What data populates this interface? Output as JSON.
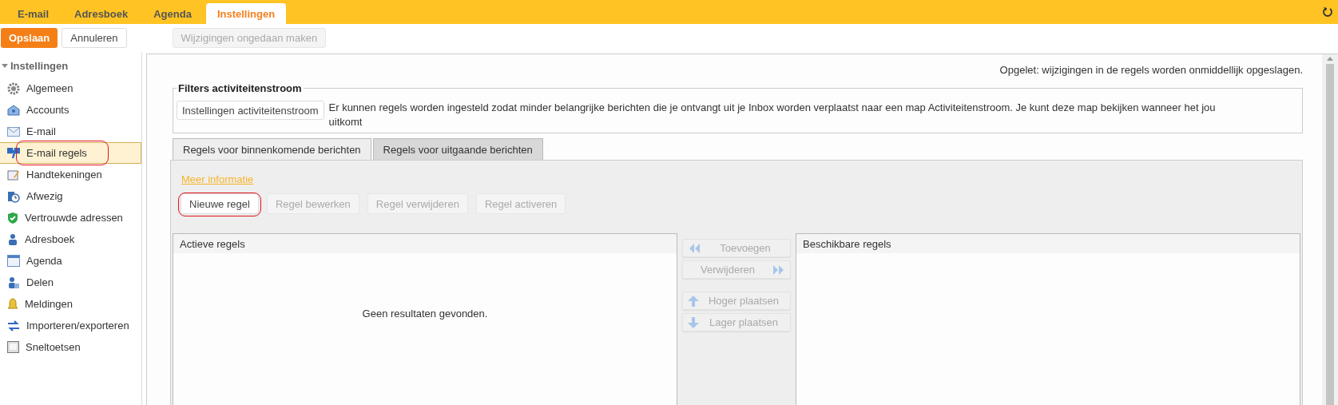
{
  "top_tabs": [
    {
      "label": "E-mail",
      "selected": false
    },
    {
      "label": "Adresboek",
      "selected": false
    },
    {
      "label": "Agenda",
      "selected": false
    },
    {
      "label": "Instellingen",
      "selected": true
    }
  ],
  "toolbar": {
    "save": "Opslaan",
    "cancel": "Annuleren",
    "undo": {
      "label": "Wijzigingen ongedaan maken",
      "disabled": true
    }
  },
  "sidebar": {
    "title": "Instellingen",
    "expanded": true,
    "items": [
      {
        "label": "Algemeen",
        "kind": "gear",
        "selected": false,
        "annotated": false
      },
      {
        "label": "Accounts",
        "kind": "account",
        "selected": false,
        "annotated": false
      },
      {
        "label": "E-mail",
        "kind": "mail",
        "selected": false,
        "annotated": false
      },
      {
        "label": "E-mail regels",
        "kind": "rules",
        "selected": true,
        "annotated": true
      },
      {
        "label": "Handtekeningen",
        "kind": "signature",
        "selected": false,
        "annotated": false
      },
      {
        "label": "Afwezig",
        "kind": "away",
        "selected": false,
        "annotated": false
      },
      {
        "label": "Vertrouwde adressen",
        "kind": "shield",
        "selected": false,
        "annotated": false
      },
      {
        "label": "Adresboek",
        "kind": "person",
        "selected": false,
        "annotated": false
      },
      {
        "label": "Agenda",
        "kind": "calendar",
        "selected": false,
        "annotated": false
      },
      {
        "label": "Delen",
        "kind": "share",
        "selected": false,
        "annotated": false
      },
      {
        "label": "Meldingen",
        "kind": "bell",
        "selected": false,
        "annotated": false
      },
      {
        "label": "Importeren/exporteren",
        "kind": "arrows",
        "selected": false,
        "annotated": false
      },
      {
        "label": "Sneltoetsen",
        "kind": "key",
        "selected": false,
        "annotated": false
      }
    ]
  },
  "notice": "Opgelet: wijzigingen in de regels worden onmiddellijk opgeslagen.",
  "filters": {
    "legend": "Filters activiteitenstroom",
    "button": "Instellingen activiteitenstroom",
    "description": "Er kunnen regels worden ingesteld zodat minder belangrijke berichten die je ontvangt uit je Inbox worden verplaatst naar een map Activiteitenstroom. Je kunt deze map bekijken wanneer het jou uitkomt"
  },
  "rule_tabs": [
    {
      "label": "Regels voor binnenkomende berichten",
      "selected": true
    },
    {
      "label": "Regels voor uitgaande berichten",
      "selected": false
    }
  ],
  "more_info": "Meer informatie",
  "rule_buttons": [
    {
      "label": "Nieuwe regel",
      "disabled": false,
      "annotated": true
    },
    {
      "label": "Regel bewerken",
      "disabled": true,
      "annotated": false
    },
    {
      "label": "Regel verwijderen",
      "disabled": true,
      "annotated": false
    },
    {
      "label": "Regel activeren",
      "disabled": true,
      "annotated": false
    }
  ],
  "active_rules": {
    "title": "Actieve regels",
    "empty": "Geen resultaten gevonden."
  },
  "move_buttons": [
    {
      "label": "Toevoegen",
      "kind": "left",
      "disabled": true
    },
    {
      "label": "Verwijderen",
      "kind": "right",
      "disabled": true
    },
    {
      "label": "Hoger plaatsen",
      "kind": "up",
      "disabled": true
    },
    {
      "label": "Lager plaatsen",
      "kind": "down",
      "disabled": true
    }
  ],
  "available_rules": {
    "title": "Beschikbare regels"
  }
}
